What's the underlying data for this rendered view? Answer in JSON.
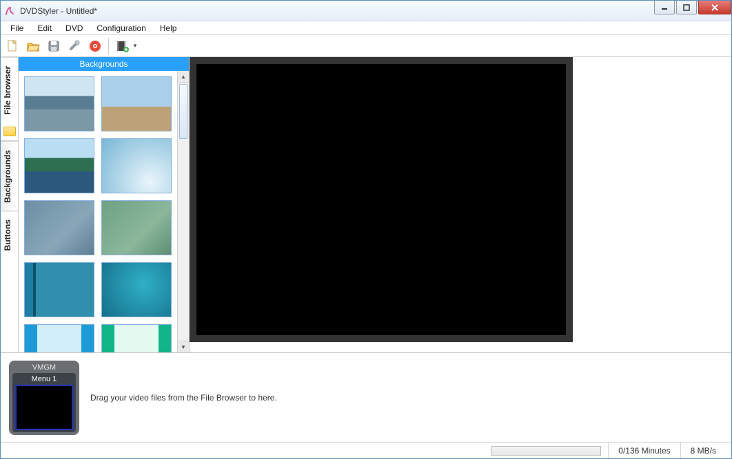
{
  "window": {
    "title": "DVDStyler - Untitled*"
  },
  "menu": {
    "items": [
      "File",
      "Edit",
      "DVD",
      "Configuration",
      "Help"
    ]
  },
  "toolbar": {
    "icons": [
      "new-project-icon",
      "open-icon",
      "save-icon",
      "settings-icon",
      "burn-icon",
      "add-file-icon"
    ]
  },
  "side_tabs": {
    "items": [
      "File browser",
      "Backgrounds",
      "Buttons"
    ],
    "active_index": 1
  },
  "backgrounds_panel": {
    "header": "Backgrounds",
    "thumbs": [
      "t1",
      "t2",
      "t3",
      "t4",
      "t5",
      "t6",
      "t7",
      "t8",
      "t9",
      "t10"
    ]
  },
  "timeline": {
    "vmgm_label": "VMGM",
    "menu_label": "Menu 1",
    "hint": "Drag your video files from the File Browser to here."
  },
  "status": {
    "minutes": "0/136 Minutes",
    "bitrate": "8 MB/s"
  }
}
